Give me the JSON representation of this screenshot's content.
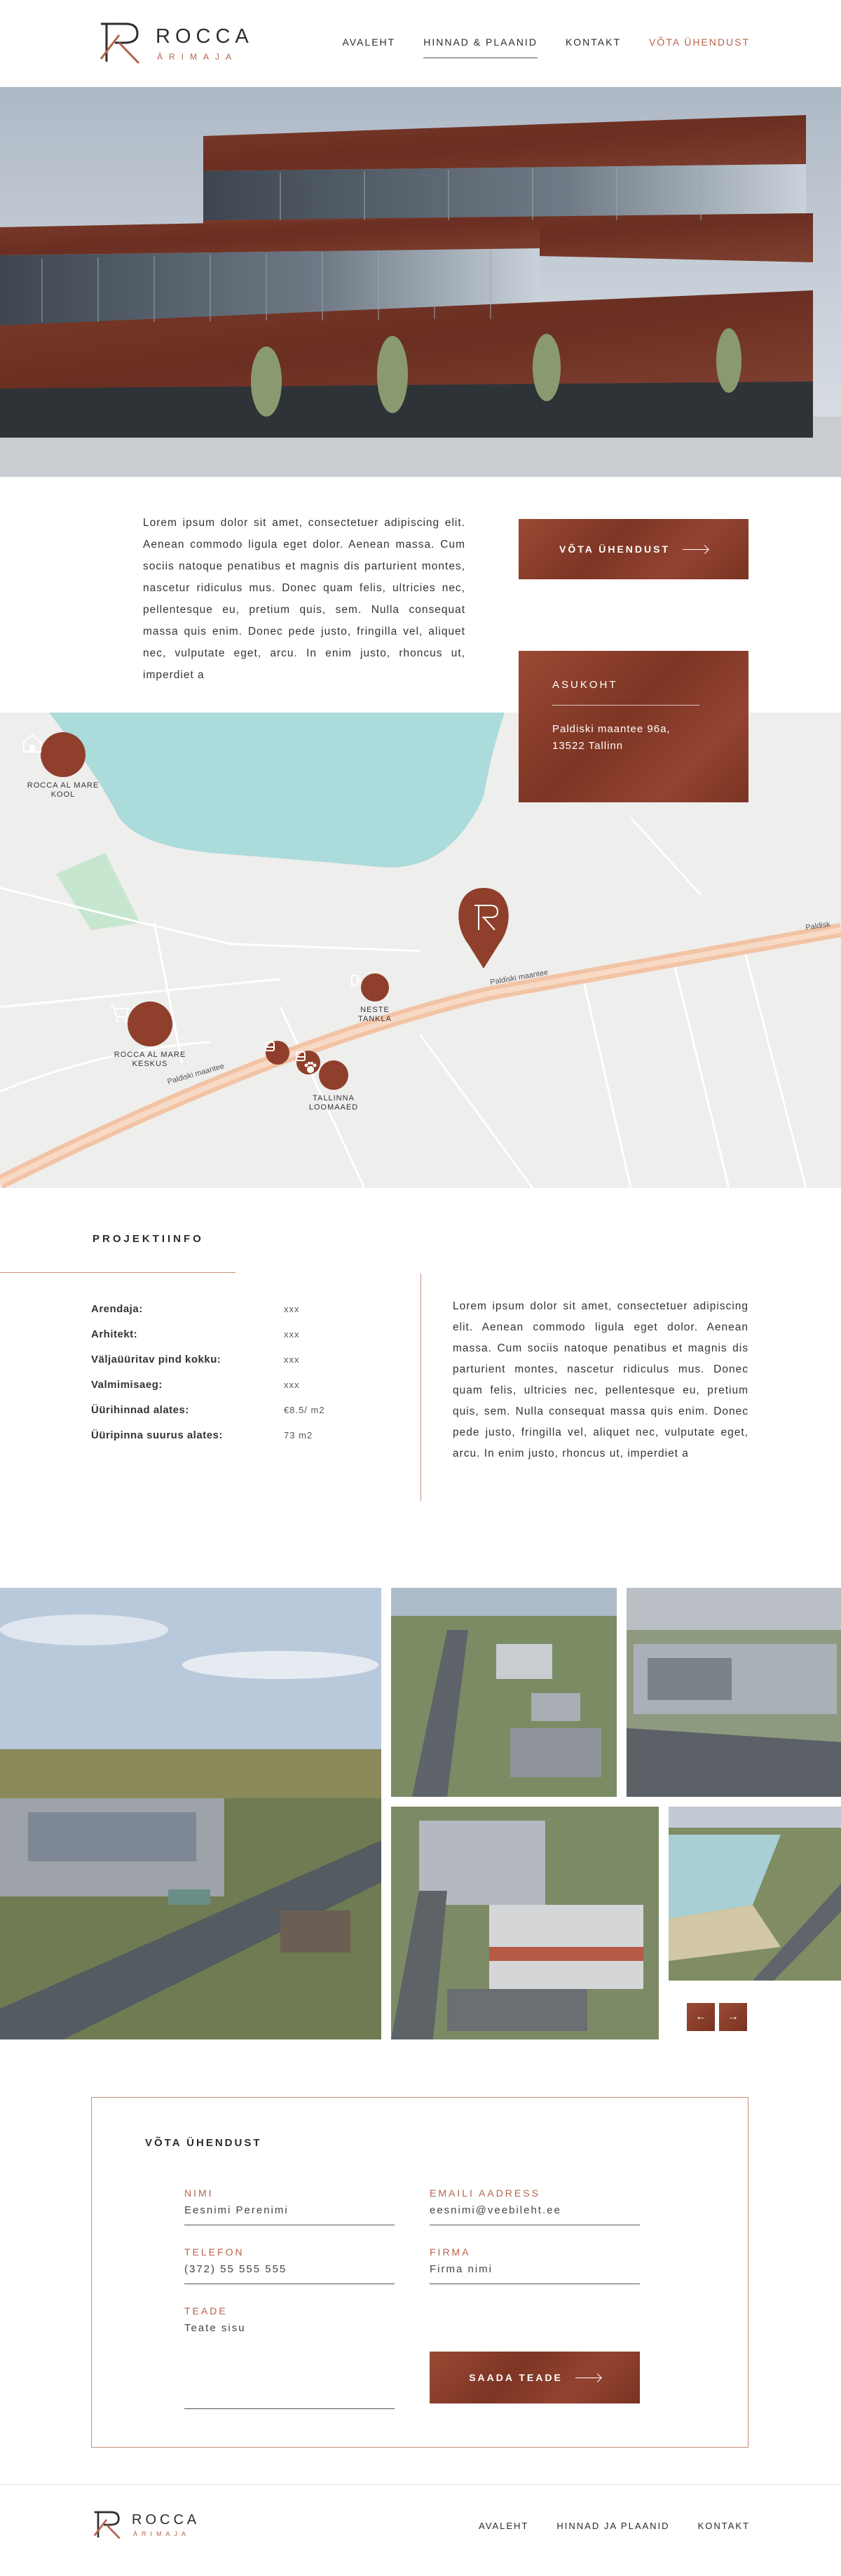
{
  "brand": {
    "name": "ROCCA",
    "sub": "ÄRIMAJA"
  },
  "nav": {
    "items": [
      {
        "label": "AVALEHT"
      },
      {
        "label": "HINNAD & PLAANID"
      },
      {
        "label": "KONTAKT"
      },
      {
        "label": "VÕTA ÜHENDUST"
      }
    ]
  },
  "intro": {
    "text": "Lorem ipsum dolor sit amet, consectetuer adipiscing elit. Aenean commodo ligula eget dolor. Aenean massa. Cum sociis natoque penatibus et magnis dis parturient montes, nascetur ridiculus mus. Donec quam felis, ultricies nec, pellentesque eu, pretium quis, sem. Nulla consequat massa quis enim. Donec pede justo, fringilla vel, aliquet nec, vulputate eget, arcu. In enim justo, rhoncus ut, imperdiet a",
    "button_label": "VÕTA ÜHENDUST"
  },
  "location": {
    "title": "ASUKOHT",
    "address_line1": "Paldiski maantee 96a,",
    "address_line2": "13522 Tallinn"
  },
  "map": {
    "road_labels": [
      "Paldiski maantee",
      "Paldiski maantee",
      "Paldiski maantee",
      "Paldisk"
    ],
    "pois": [
      {
        "label1": "ROCCA AL MARE",
        "label2": "KOOL"
      },
      {
        "label1": "ROCCA AL MARE",
        "label2": "KESKUS"
      },
      {
        "label1": "NESTE",
        "label2": "TANKLA"
      },
      {
        "label1": "TALLINNA",
        "label2": "LOOMAAED"
      }
    ]
  },
  "project": {
    "title": "PROJEKTIINFO",
    "rows": [
      {
        "label": "Arendaja:",
        "value": "xxx"
      },
      {
        "label": "Arhitekt:",
        "value": "xxx"
      },
      {
        "label": "Väljaüüritav pind kokku:",
        "value": "xxx"
      },
      {
        "label": "Valmimisaeg:",
        "value": "xxx"
      },
      {
        "label": "Üürihinnad alates:",
        "value": "€8.5/ m2"
      },
      {
        "label": "Üüripinna suurus alates:",
        "value": "73 m2"
      }
    ],
    "text": "Lorem ipsum dolor sit amet, consectetuer adipiscing elit. Aenean commodo ligula eget dolor. Aenean massa. Cum sociis natoque penatibus et magnis dis parturient montes, nascetur ridiculus mus. Donec quam felis, ultricies nec, pellentesque eu, pretium quis, sem. Nulla consequat massa quis enim. Donec pede justo, fringilla vel, aliquet nec, vulputate eget, arcu. In enim justo, rhoncus ut, imperdiet a"
  },
  "gallery": {
    "prev": "←",
    "next": "→"
  },
  "form": {
    "title": "VÕTA ÜHENDUST",
    "name_label": "NIMI",
    "name_value": "Eesnimi Perenimi",
    "email_label": "EMAILI AADRESS",
    "email_value": "eesnimi@veebileht.ee",
    "phone_label": "TELEFON",
    "phone_value": "(372) 55 555 555",
    "company_label": "FIRMA",
    "company_value": "Firma nimi",
    "message_label": "TEADE",
    "message_value": "Teate sisu",
    "submit_label": "SAADA TEADE"
  },
  "footer": {
    "nav": [
      {
        "label": "AVALEHT"
      },
      {
        "label": "HINNAD JA PLAANID"
      },
      {
        "label": "KONTAKT"
      }
    ]
  },
  "colors": {
    "accent": "#8f3f2b",
    "accent_light": "#b5634d",
    "line": "#c98f7e"
  }
}
